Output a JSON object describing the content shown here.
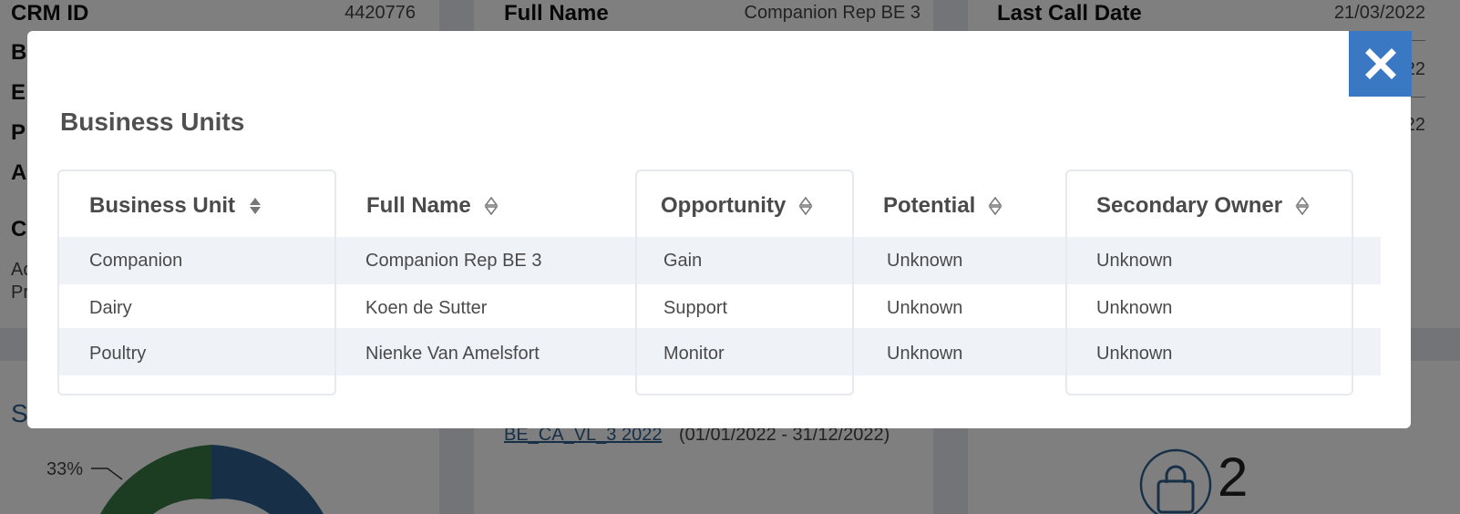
{
  "background": {
    "crm_id_label": "CRM ID",
    "crm_id_value": "4420776",
    "full_name_label": "Full Name",
    "full_name_value": "Companion Rep BE 3",
    "last_call_label": "Last Call Date",
    "last_call_value": "21/03/2022",
    "partial_date_1": "22",
    "partial_date_2": "22",
    "left_letters": [
      "B",
      "E",
      "P",
      "A",
      "C"
    ],
    "left_small_1": "Ac",
    "left_small_2": "Pr",
    "section_letter": "S",
    "plan_link": "BE_CA_VL_3 2022",
    "plan_period": "(01/01/2022 - 31/12/2022)",
    "donut_label": "33%",
    "basket_count": "2",
    "colors": {
      "donut_green": "#3b7a45",
      "donut_blue": "#2e6191",
      "accent": "#3b78c3"
    }
  },
  "modal": {
    "title": "Business Units",
    "close_icon": "close-icon",
    "columns": [
      "Business Unit",
      "Full Name",
      "Opportunity",
      "Potential",
      "Secondary Owner"
    ],
    "rows": [
      [
        "Companion",
        "Companion Rep BE 3",
        "Gain",
        "Unknown",
        "Unknown"
      ],
      [
        "Dairy",
        "Koen de Sutter",
        "Support",
        "Unknown",
        "Unknown"
      ],
      [
        "Poultry",
        "Nienke Van Amelsfort",
        "Monitor",
        "Unknown",
        "Unknown"
      ]
    ]
  }
}
